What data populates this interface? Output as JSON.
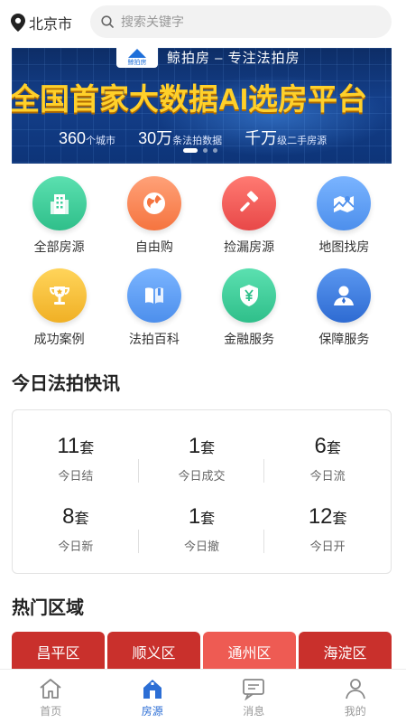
{
  "header": {
    "city": "北京市",
    "search_placeholder": "搜索关键字"
  },
  "banner": {
    "logo_text": "鲸拍房",
    "slogan": "鲸拍房 – 专注法拍房",
    "headline": "全国首家大数据AI选房平台",
    "stats": [
      {
        "value": "360",
        "unit": "个城市"
      },
      {
        "value": "30万",
        "unit": "条法拍数据"
      },
      {
        "value": "千万",
        "unit": "级二手房源"
      }
    ],
    "slide_count": 3,
    "active_slide": 1
  },
  "categories": [
    {
      "label": "全部房源",
      "icon": "buildings-icon",
      "color": "#3fcf9c"
    },
    {
      "label": "自由购",
      "icon": "globe-icon",
      "color": "#ff8a5a"
    },
    {
      "label": "捡漏房源",
      "icon": "gavel-icon",
      "color": "#f35b5b"
    },
    {
      "label": "地图找房",
      "icon": "map-icon",
      "color": "#5b9cf3"
    },
    {
      "label": "成功案例",
      "icon": "trophy-icon",
      "color": "#f7c238"
    },
    {
      "label": "法拍百科",
      "icon": "book-icon",
      "color": "#5b9cf3"
    },
    {
      "label": "金融服务",
      "icon": "shield-yen-icon",
      "color": "#3fcf9c"
    },
    {
      "label": "保障服务",
      "icon": "user-badge-icon",
      "color": "#3d7de0"
    }
  ],
  "news": {
    "title": "今日法拍快讯",
    "stats": [
      {
        "value": "11",
        "unit": "套",
        "label": "今日结"
      },
      {
        "value": "1",
        "unit": "套",
        "label": "今日成交"
      },
      {
        "value": "6",
        "unit": "套",
        "label": "今日流"
      },
      {
        "value": "8",
        "unit": "套",
        "label": "今日新"
      },
      {
        "value": "1",
        "unit": "套",
        "label": "今日撤"
      },
      {
        "value": "12",
        "unit": "套",
        "label": "今日开"
      }
    ]
  },
  "areas": {
    "title": "热门区域",
    "items": [
      {
        "label": "昌平区",
        "color": "#c9302c"
      },
      {
        "label": "顺义区",
        "color": "#c9302c"
      },
      {
        "label": "通州区",
        "color": "#ee5b53"
      },
      {
        "label": "海淀区",
        "color": "#c9302c"
      }
    ]
  },
  "tabbar": {
    "items": [
      {
        "label": "首页",
        "icon": "home-icon",
        "active": false
      },
      {
        "label": "房源",
        "icon": "house-icon",
        "active": true
      },
      {
        "label": "消息",
        "icon": "message-icon",
        "active": false
      },
      {
        "label": "我的",
        "icon": "profile-icon",
        "active": false
      }
    ],
    "active_color": "#2c6ed5",
    "inactive_color": "#999999"
  }
}
